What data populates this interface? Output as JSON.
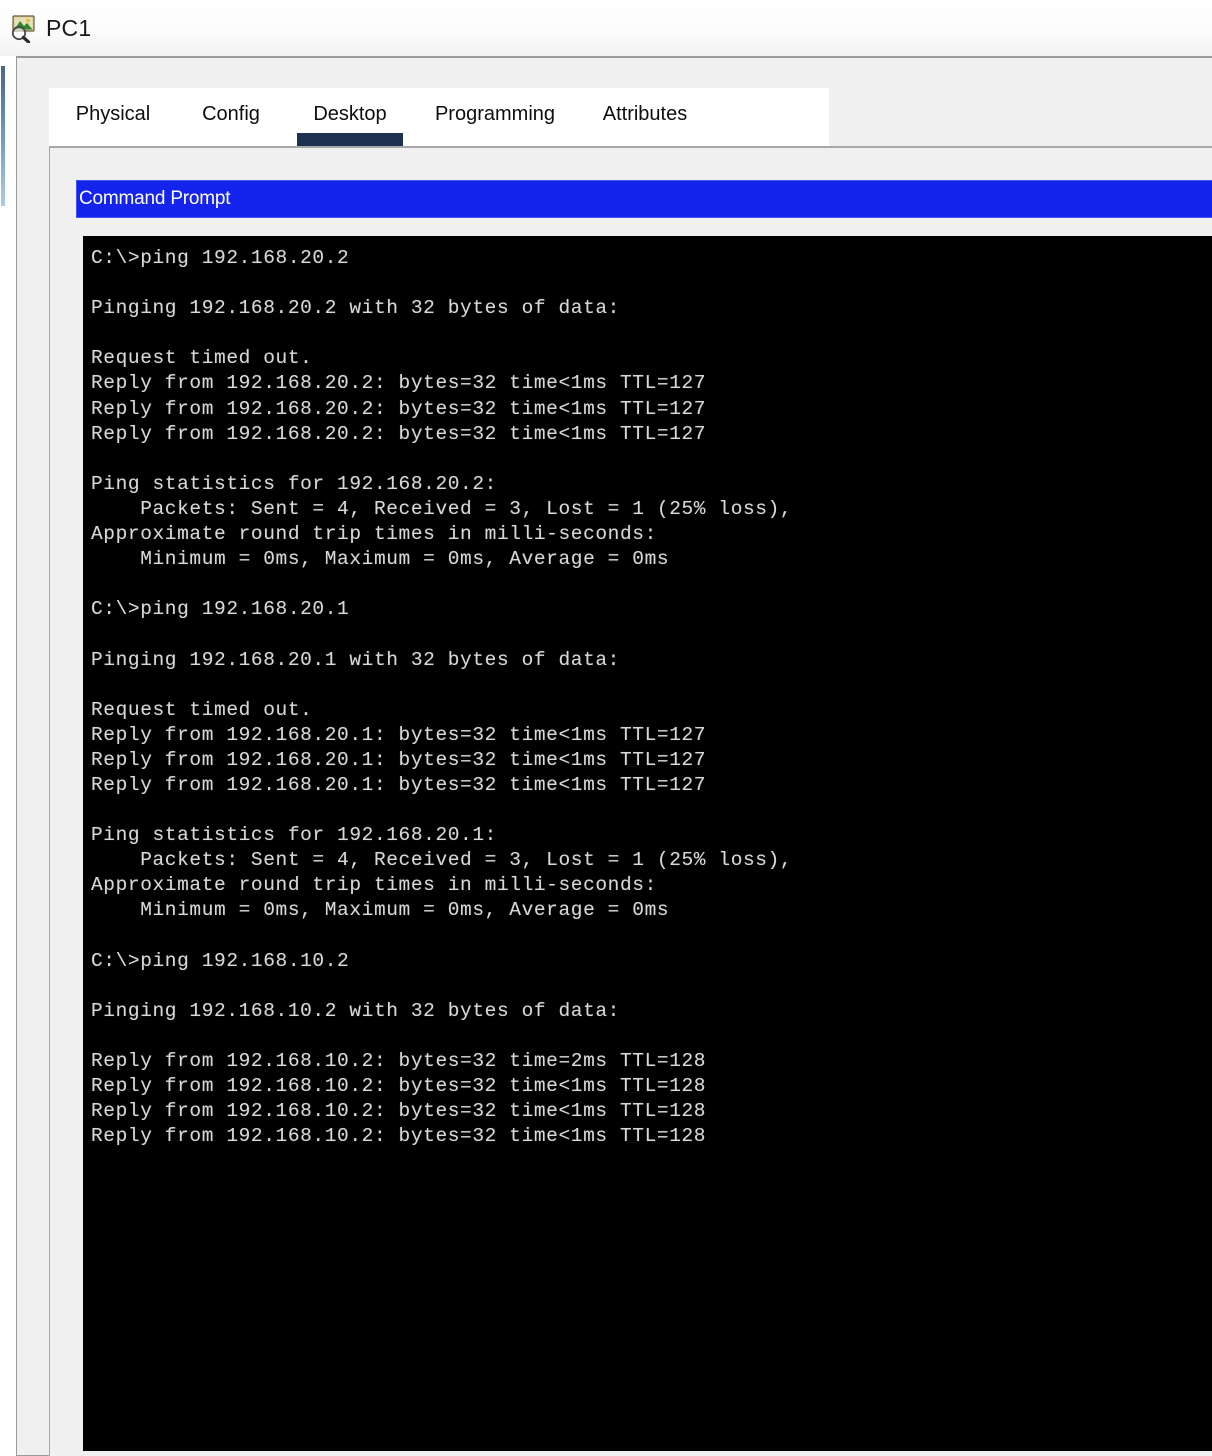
{
  "window": {
    "title": "PC1",
    "icon": "device-inspect-icon"
  },
  "tabs": [
    {
      "label": "Physical",
      "name": "tab-physical",
      "active": false
    },
    {
      "label": "Config",
      "name": "tab-config",
      "active": false
    },
    {
      "label": "Desktop",
      "name": "tab-desktop",
      "active": true
    },
    {
      "label": "Programming",
      "name": "tab-programming",
      "active": false
    },
    {
      "label": "Attributes",
      "name": "tab-attributes",
      "active": false
    }
  ],
  "command_prompt": {
    "title": "Command Prompt",
    "header_background": "#1524ec",
    "terminal_background": "#000000",
    "terminal_foreground": "#d8d8d8",
    "lines": [
      "C:\\>ping 192.168.20.2",
      "",
      "Pinging 192.168.20.2 with 32 bytes of data:",
      "",
      "Request timed out.",
      "Reply from 192.168.20.2: bytes=32 time<1ms TTL=127",
      "Reply from 192.168.20.2: bytes=32 time<1ms TTL=127",
      "Reply from 192.168.20.2: bytes=32 time<1ms TTL=127",
      "",
      "Ping statistics for 192.168.20.2:",
      "    Packets: Sent = 4, Received = 3, Lost = 1 (25% loss),",
      "Approximate round trip times in milli-seconds:",
      "    Minimum = 0ms, Maximum = 0ms, Average = 0ms",
      "",
      "C:\\>ping 192.168.20.1",
      "",
      "Pinging 192.168.20.1 with 32 bytes of data:",
      "",
      "Request timed out.",
      "Reply from 192.168.20.1: bytes=32 time<1ms TTL=127",
      "Reply from 192.168.20.1: bytes=32 time<1ms TTL=127",
      "Reply from 192.168.20.1: bytes=32 time<1ms TTL=127",
      "",
      "Ping statistics for 192.168.20.1:",
      "    Packets: Sent = 4, Received = 3, Lost = 1 (25% loss),",
      "Approximate round trip times in milli-seconds:",
      "    Minimum = 0ms, Maximum = 0ms, Average = 0ms",
      "",
      "C:\\>ping 192.168.10.2",
      "",
      "Pinging 192.168.10.2 with 32 bytes of data:",
      "",
      "Reply from 192.168.10.2: bytes=32 time=2ms TTL=128",
      "Reply from 192.168.10.2: bytes=32 time<1ms TTL=128",
      "Reply from 192.168.10.2: bytes=32 time<1ms TTL=128",
      "Reply from 192.168.10.2: bytes=32 time<1ms TTL=128"
    ]
  }
}
